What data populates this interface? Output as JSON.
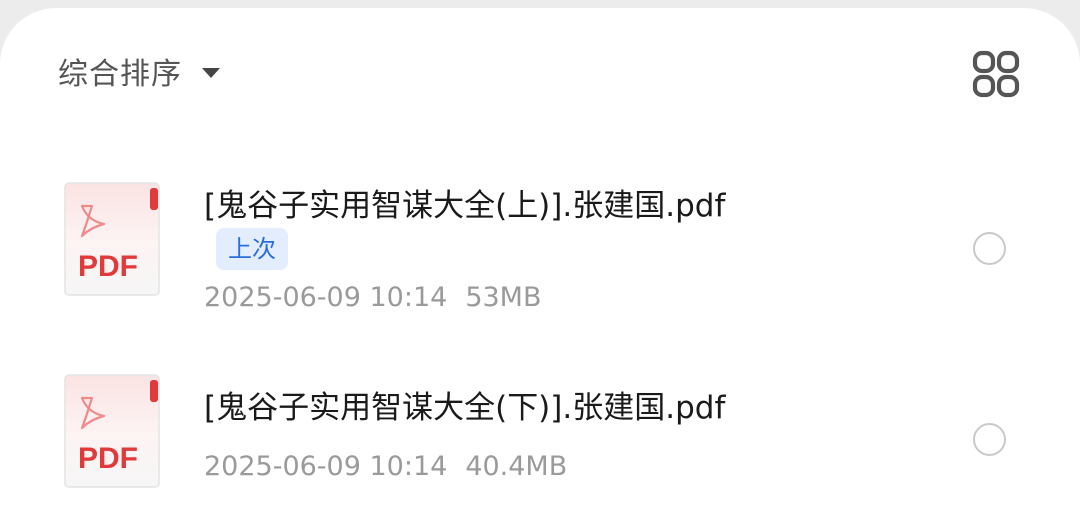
{
  "toolbar": {
    "sort_label": "综合排序",
    "sort_icon": "caret-down-icon",
    "view_toggle_icon": "grid-view-icon"
  },
  "files": [
    {
      "name": "[鬼谷子实用智谋大全(上)].张建国.pdf",
      "badge": "上次",
      "date": "2025-06-09 10:14",
      "size": "53MB",
      "icon": "pdf-file-icon",
      "icon_label": "PDF"
    },
    {
      "name": "[鬼谷子实用智谋大全(下)].张建国.pdf",
      "date": "2025-06-09 10:14",
      "size": "40.4MB",
      "icon": "pdf-file-icon",
      "icon_label": "PDF"
    }
  ],
  "colors": {
    "pdf_red": "#e03a3a",
    "badge_text": "#2a6fdb",
    "badge_bg": "#e3edfd",
    "meta_gray": "#9a9a9a"
  }
}
